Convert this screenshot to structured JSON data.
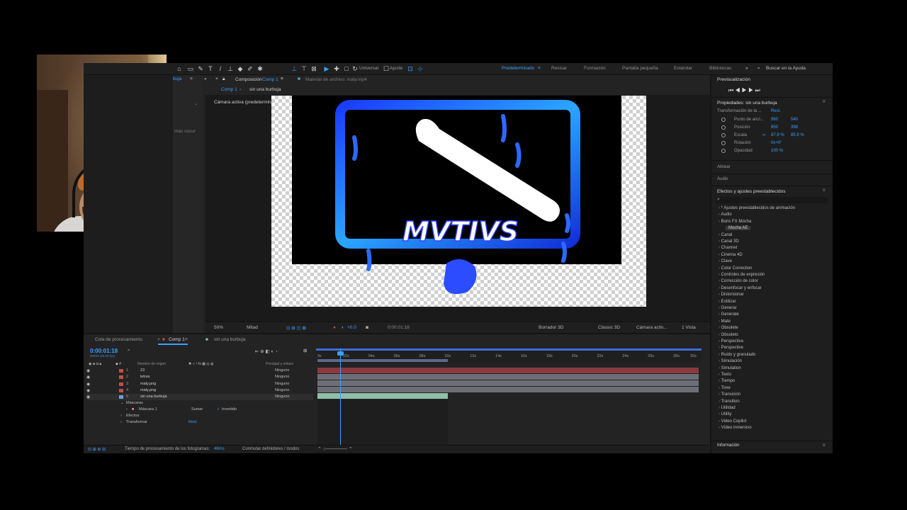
{
  "toolbar": {
    "universal_label": "Universal",
    "ajuste_label": "Ajuste",
    "workspaces": [
      "Predeterminado",
      "Revisar",
      "Formación",
      "Pantalla pequeña",
      "Estándar",
      "Bibliotecas"
    ],
    "search_placeholder": "Buscar en la Ayuda"
  },
  "project": {
    "tab_label": "buja",
    "dropdown_text": "más oscur"
  },
  "comp_panel": {
    "comp_label": "Composición",
    "comp_name": "Comp 1",
    "material_label": "Material de archivo: maty.mp4",
    "breadcrumb_comp": "Comp 1",
    "breadcrumb_layer": "sin una burbuja",
    "camera_label": "Cámara activa (predeterminada)",
    "artwork_text": "MVTIVS"
  },
  "viewer_bar": {
    "zoom": "50%",
    "resolution": "Mitad",
    "plus_value": "+0.0",
    "timecode": "0:00:01:18",
    "renderer": "Borrador 3D",
    "renderer_mode": "Classic 3D",
    "camera": "Cámara activ...",
    "views": "1 Vista"
  },
  "right_panel": {
    "preview_title": "Previsualización",
    "properties_title": "Propiedades: sin una burbuja",
    "transform_label": "Transformación de la ...",
    "reset_label": "Rest.",
    "props": [
      {
        "label": "Punto de ancl...",
        "v1": "960",
        "v2": "540"
      },
      {
        "label": "Posición",
        "v1": "950",
        "v2": "398"
      },
      {
        "label": "Escala",
        "v1": "87.9 %",
        "v2": "85.9 %"
      },
      {
        "label": "Rotación",
        "v1": "0x+0°",
        "v2": ""
      },
      {
        "label": "Opacidad",
        "v1": "100 %",
        "v2": ""
      }
    ],
    "align_label": "Alinear",
    "audio_label": "Audio",
    "effects_title": "Efectos y ajustes preestablecidos",
    "effects_search": "",
    "effects": [
      "* Ajustes preestablecidos de animación",
      "Audio",
      "Boris FX Mocha"
    ],
    "mocha_item": "Mocha AE",
    "categories": [
      "Canal",
      "Canal 3D",
      "Channel",
      "Cinema 4D",
      "Clave",
      "Color Correction",
      "Controles de expresión",
      "Corrección de color",
      "Desenfocar y enfocar",
      "Distorsionar",
      "Estilizar",
      "Generar",
      "Generate",
      "Mate",
      "Obsolete",
      "Obsoleto",
      "Perspectiva",
      "Perspective",
      "Ruido y granulado",
      "Simulación",
      "Simulation",
      "Texto",
      "Tiempo",
      "Time",
      "Transición",
      "Transition",
      "Utilidad",
      "Utility",
      "Video Copilot",
      "Vídeo inmersivo"
    ],
    "info_label": "Información"
  },
  "timeline": {
    "tab_queue": "Cola de procesamiento",
    "tab_comp": "Comp 1",
    "tab_other": "sin una burbuja",
    "timecode": "0:00:01:18",
    "fps": "00043 (25.00 fps)",
    "col_name": "Nombre de origen",
    "col_parent": "Principal y enlace",
    "layers": [
      {
        "num": "1",
        "name": "23",
        "mode": "Ninguno",
        "color": "#c84a4a"
      },
      {
        "num": "2",
        "name": "letras",
        "mode": "Ninguno",
        "color": "#c84a4a"
      },
      {
        "num": "3",
        "name": "maty.png",
        "mode": "Ninguno",
        "color": "#c84a4a"
      },
      {
        "num": "4",
        "name": "maty.png",
        "mode": "Ninguno",
        "color": "#c84a4a"
      },
      {
        "num": "5",
        "name": "sin una burbuja",
        "mode": "Ninguno",
        "color": "#6aa0d8"
      }
    ],
    "masks_label": "Máscaras",
    "mask1_label": "Máscara 1",
    "mask_mode": "Sumar",
    "inverted_label": "Invertido",
    "effects_label": "Efectos",
    "transform_label": "Transformar",
    "reset_label": "Rest.",
    "ticks": [
      "0s",
      "02s",
      "04s",
      "06s",
      "08s",
      "10s",
      "12s",
      "14s",
      "16s",
      "18s",
      "20s",
      "22s",
      "24s",
      "26s",
      "28s",
      "30s"
    ],
    "status_text": "Tiempo de procesamiento de los fotogramas:",
    "status_ms": "46ms",
    "status_toggle": "Conmutar definidores / modos"
  },
  "colors": {
    "accent": "#3aa0ff",
    "layer_red": "#8a3a3e",
    "layer_gray": "#6e6e78",
    "layer_teal": "#8fbfa6"
  }
}
